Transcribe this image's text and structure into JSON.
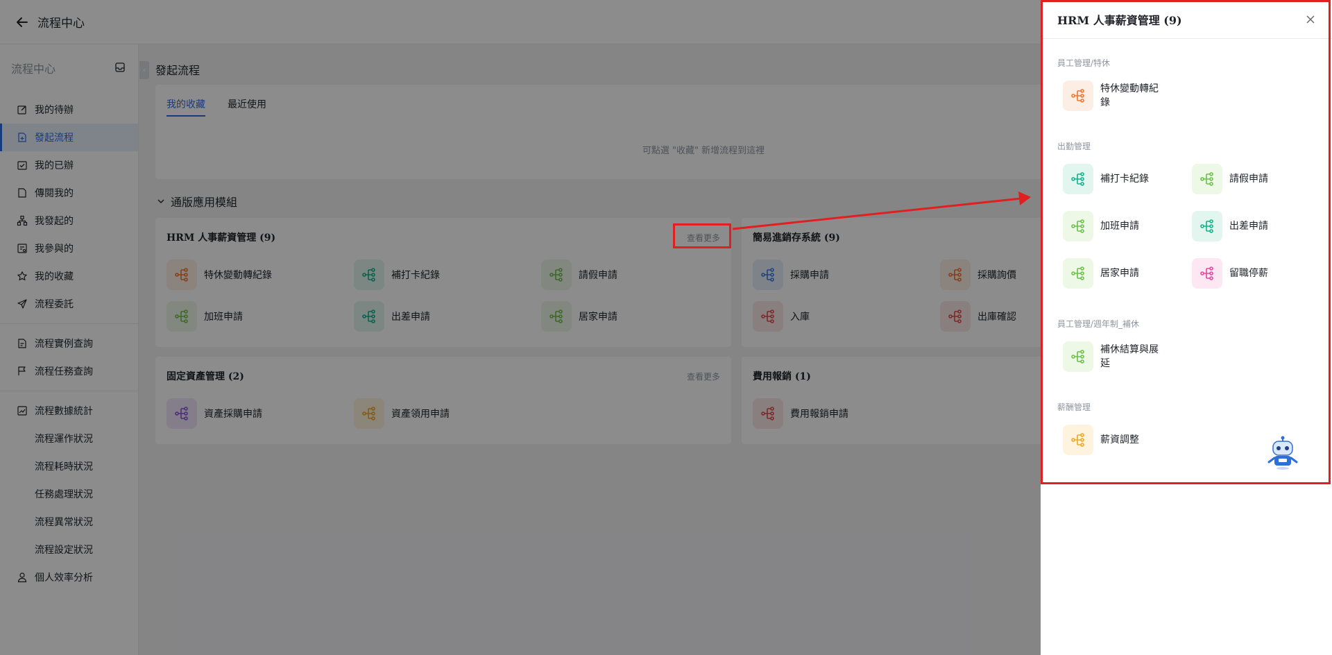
{
  "topbar": {
    "title": "流程中心"
  },
  "sidebar": {
    "header": "流程中心",
    "items": [
      {
        "label": "我的待辦",
        "icon": "edit-icon"
      },
      {
        "label": "發起流程",
        "icon": "file-plus-icon",
        "active": true
      },
      {
        "label": "我的已辦",
        "icon": "check-square-icon"
      },
      {
        "label": "傳閱我的",
        "icon": "document-icon"
      },
      {
        "label": "我發起的",
        "icon": "org-chart-icon"
      },
      {
        "label": "我參與的",
        "icon": "form-icon"
      },
      {
        "label": "我的收藏",
        "icon": "star-icon"
      },
      {
        "label": "流程委託",
        "icon": "send-icon"
      }
    ],
    "query_items": [
      {
        "label": "流程實例查詢",
        "icon": "document-search-icon"
      },
      {
        "label": "流程任務查詢",
        "icon": "flag-icon"
      }
    ],
    "stats": {
      "label": "流程數據統計",
      "children": [
        "流程運作狀況",
        "流程耗時狀況",
        "任務處理狀況",
        "流程異常狀況",
        "流程設定狀況"
      ]
    },
    "personal": {
      "label": "個人效率分析",
      "icon": "user-icon"
    }
  },
  "main": {
    "title": "發起流程",
    "tabs": [
      {
        "label": "我的收藏",
        "active": true
      },
      {
        "label": "最近使用"
      }
    ],
    "empty_hint": "可點選 \"收藏\" 新增流程到這裡",
    "section_title": "通版應用模組",
    "modules": [
      {
        "title": "HRM 人事薪資管理 (9)",
        "more": "查看更多",
        "apps": [
          {
            "label": "特休變動轉紀錄",
            "color": "#f2742e"
          },
          {
            "label": "補打卡紀錄",
            "color": "#10b38a"
          },
          {
            "label": "請假申請",
            "color": "#6cc04a"
          },
          {
            "label": "加班申請",
            "color": "#6cc04a"
          },
          {
            "label": "出差申請",
            "color": "#10b38a"
          },
          {
            "label": "居家申請",
            "color": "#6cc04a"
          }
        ]
      },
      {
        "title": "簡易進銷存系統 (9)",
        "apps": [
          {
            "label": "採購申請",
            "color": "#3b7be6"
          },
          {
            "label": "採購詢價",
            "color": "#f2742e"
          },
          {
            "label": "入庫",
            "color": "#e34b4b"
          },
          {
            "label": "出庫確認",
            "color": "#e34b4b"
          }
        ]
      },
      {
        "title": "固定資產管理 (2)",
        "more": "查看更多",
        "apps": [
          {
            "label": "資產採購申請",
            "color": "#8a52e0"
          },
          {
            "label": "資產領用申請",
            "color": "#f0a71f"
          }
        ]
      },
      {
        "title": "費用報銷 (1)",
        "apps": [
          {
            "label": "費用報銷申請",
            "color": "#e34b4b"
          }
        ]
      }
    ]
  },
  "drawer": {
    "title": "HRM 人事薪資管理 (9)",
    "groups": [
      {
        "label": "員工管理/特休",
        "apps": [
          {
            "label": "特休變動轉紀錄",
            "color": "#f2742e"
          }
        ]
      },
      {
        "label": "出勤管理",
        "apps": [
          {
            "label": "補打卡紀錄",
            "color": "#10b38a"
          },
          {
            "label": "請假申請",
            "color": "#6cc04a"
          },
          {
            "label": "加班申請",
            "color": "#6cc04a"
          },
          {
            "label": "出差申請",
            "color": "#10b38a"
          },
          {
            "label": "居家申請",
            "color": "#6cc04a"
          },
          {
            "label": "留職停薪",
            "color": "#e8479b"
          }
        ]
      },
      {
        "label": "員工管理/週年制_補休",
        "apps": [
          {
            "label": "補休結算與展延",
            "color": "#6cc04a"
          }
        ]
      },
      {
        "label": "薪酬管理",
        "apps": [
          {
            "label": "薪資調整",
            "color": "#f0a71f"
          }
        ]
      }
    ]
  },
  "annotation": {
    "highlight_color": "#e02020"
  }
}
